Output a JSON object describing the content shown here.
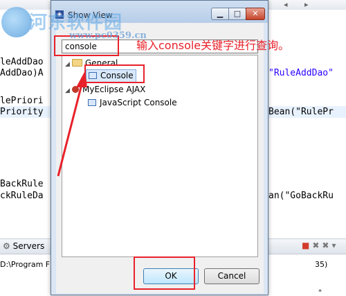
{
  "background": {
    "code_lines": [
      {
        "text": "leAddDao",
        "str": "",
        "tail": ""
      },
      {
        "text": "AddDao)A",
        "str": "\"RuleAddDao\"",
        "tail": ""
      },
      {
        "text": "lePriori",
        "str": "",
        "tail": ""
      },
      {
        "text": "Priority",
        "str": "",
        "tail": "Bean(\"RulePr"
      },
      {
        "text": "BackRule",
        "str": "",
        "tail": ""
      },
      {
        "text": "ckRuleDa",
        "str": "",
        "tail": "an(\"GoBackRu"
      }
    ],
    "bottom_panel": {
      "tab_label": "Servers",
      "path_text": "D:\\Program F",
      "path_tail": "35)"
    }
  },
  "dialog": {
    "title": "Show View",
    "filter_value": "console",
    "tree": [
      {
        "label": "General",
        "icon": "folder-icon"
      },
      {
        "label": "Console",
        "icon": "console-view-icon"
      },
      {
        "label": "MyEclipse AJAX",
        "icon": "ajax-icon"
      },
      {
        "label": "JavaScript Console",
        "icon": "console-view-icon"
      }
    ],
    "ok_label": "OK",
    "cancel_label": "Cancel"
  },
  "annotation": {
    "text": "输入console关键字进行查询。",
    "color": "#e8212a"
  },
  "watermark": {
    "text": "河东软件园",
    "url": "www.pc0359.cn"
  }
}
